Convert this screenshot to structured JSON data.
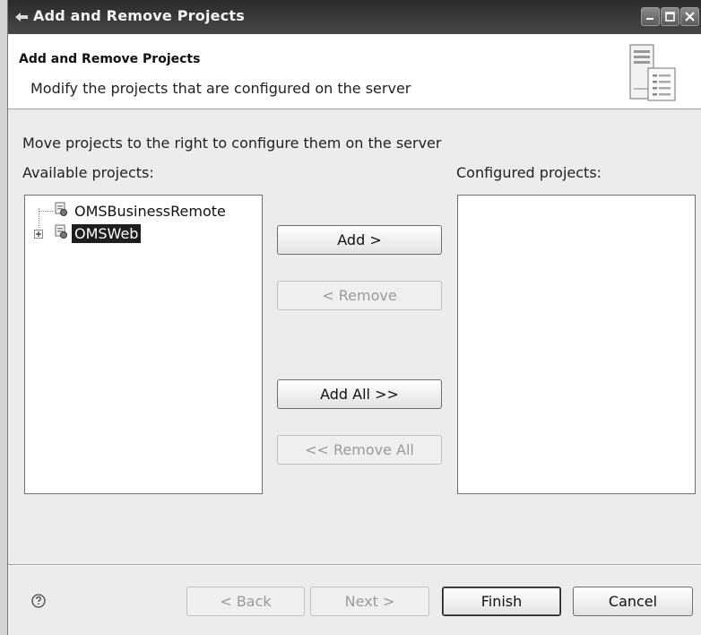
{
  "window": {
    "title": "Add and Remove Projects",
    "icons": {
      "window": "back-arrow-icon",
      "minimize": "minimize-icon",
      "maximize": "maximize-icon",
      "close": "close-icon"
    }
  },
  "banner": {
    "title": "Add and Remove Projects",
    "description": "Modify the projects that are configured on the server",
    "icon": "server-icon"
  },
  "main": {
    "instruction": "Move projects to the right to configure them on the server",
    "available_label": "Available projects:",
    "configured_label": "Configured projects:",
    "available_projects": [
      {
        "name": "OMSBusinessRemote",
        "icon": "project-icon",
        "expandable": false,
        "selected": false
      },
      {
        "name": "OMSWeb",
        "icon": "project-icon",
        "expandable": true,
        "selected": true
      }
    ],
    "configured_projects": []
  },
  "actions": {
    "add": "Add >",
    "remove": "< Remove",
    "add_all": "Add All >>",
    "remove_all": "<< Remove All"
  },
  "footer": {
    "help_icon": "help-icon",
    "back": "< Back",
    "next": "Next >",
    "finish": "Finish",
    "cancel": "Cancel"
  }
}
